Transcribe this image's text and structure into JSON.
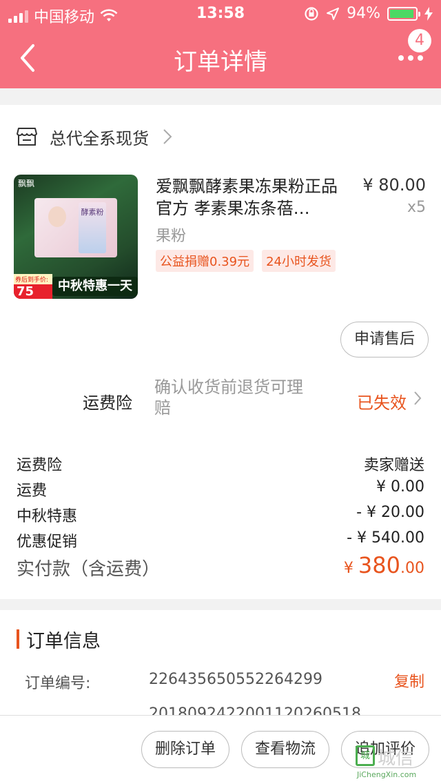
{
  "status_bar": {
    "carrier": "中国移动",
    "time": "13:58",
    "battery": "94%"
  },
  "nav": {
    "title": "订单详情",
    "badge": "4"
  },
  "shop": {
    "name": "总代全系现货"
  },
  "product": {
    "title": "爱飘飘酵素果冻果粉正品官方 孝素果冻条蓓…",
    "price": "¥ 80.00",
    "qty": "x5",
    "spec": "果粉",
    "tags": [
      "公益捐赠0.39元",
      "24小时发货"
    ],
    "thumb_logo": "飘飘",
    "thumb_pack": "酵素粉",
    "thumb_price_small": "券后到手价:",
    "thumb_price_big": "75",
    "thumb_promo": "中秋特惠一天"
  },
  "after_sale_button": "申请售后",
  "insurance": {
    "title": "运费险",
    "desc": "确认收货前退货可理赔",
    "status": "已失效"
  },
  "fees": [
    {
      "label": "运费险",
      "value": "卖家赠送"
    },
    {
      "label": "运费",
      "value": "¥ 0.00"
    },
    {
      "label": "中秋特惠",
      "value": "- ¥ 20.00"
    },
    {
      "label": "优惠促销",
      "value": "- ¥ 540.00"
    }
  ],
  "total": {
    "label": "实付款（含运费）",
    "yen": "¥ ",
    "int": "380",
    "dec": ".00"
  },
  "order_info": {
    "title": "订单信息",
    "number_label": "订单编号:",
    "number_value": "2264356505522642​99",
    "copy": "复制",
    "partial_line": "2018092422001120260518"
  },
  "bottom_buttons": {
    "delete": "删除订单",
    "logistics": "查看物流",
    "review": "追加评价"
  },
  "watermark": {
    "box": "城",
    "text": "城信",
    "url": "JiChengXin.com"
  },
  "colors": {
    "header": "#f6707f",
    "accent": "#e8541e"
  }
}
